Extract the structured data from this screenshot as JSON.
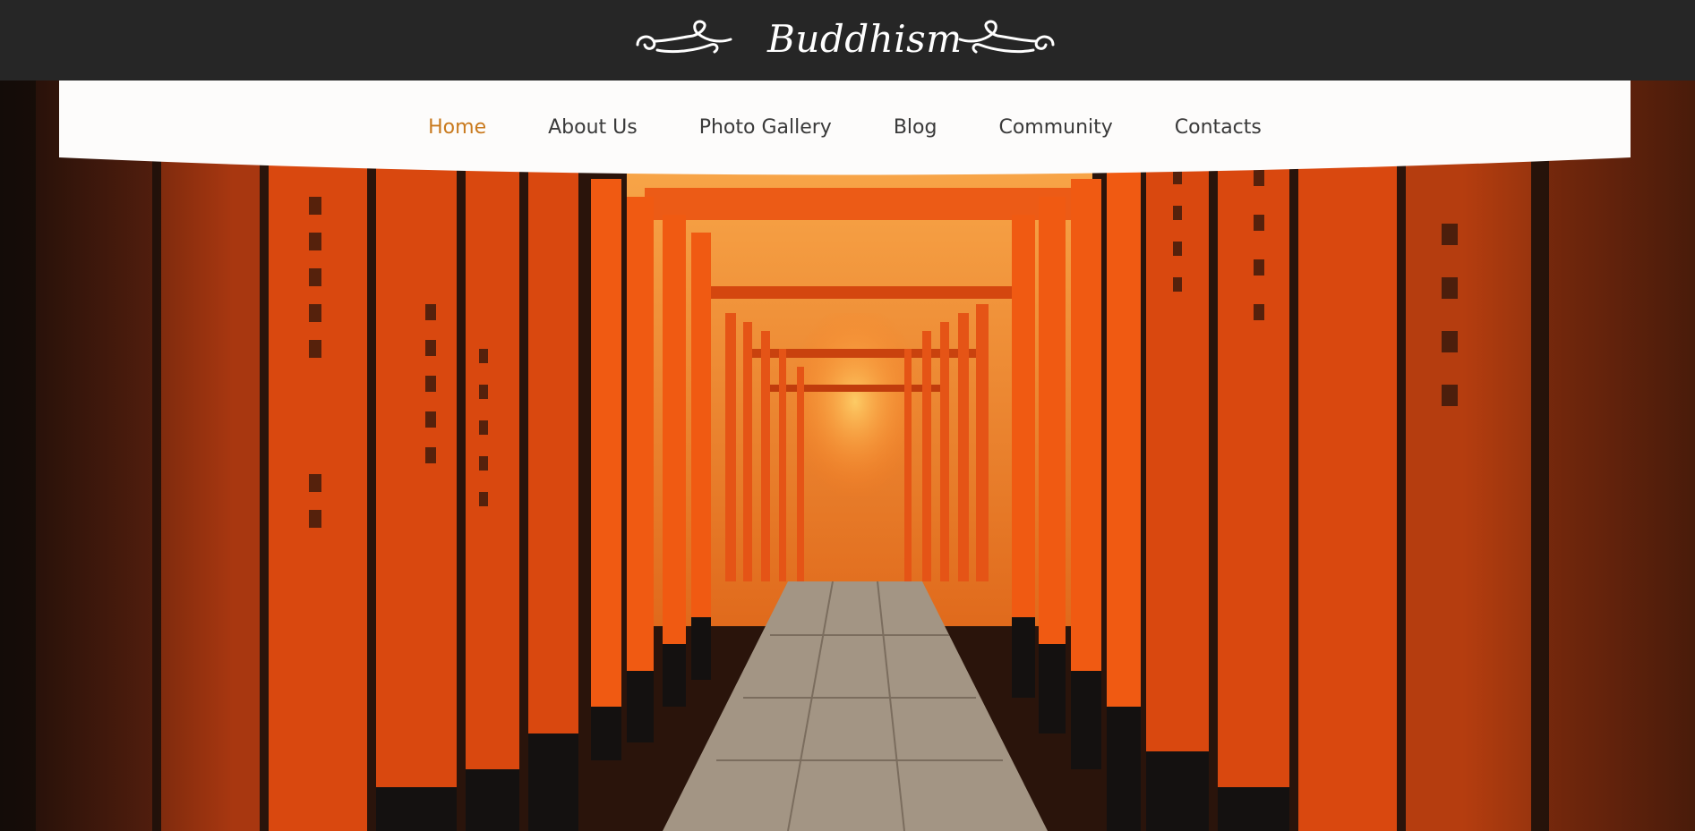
{
  "header": {
    "site_title": "Buddhism",
    "colors": {
      "bar": "#262626",
      "title": "#ffffff"
    },
    "icons": [
      "flourish-left-icon",
      "flourish-right-icon"
    ]
  },
  "nav": {
    "items": [
      {
        "label": "Home",
        "active": true
      },
      {
        "label": "About Us",
        "active": false
      },
      {
        "label": "Photo Gallery",
        "active": false
      },
      {
        "label": "Blog",
        "active": false
      },
      {
        "label": "Community",
        "active": false
      },
      {
        "label": "Contacts",
        "active": false
      }
    ],
    "colors": {
      "text": "#3a3a3a",
      "active": "#c97a1e",
      "band": "#fdfcfb"
    }
  },
  "hero": {
    "subject": "torii-gates-path-photo",
    "colors": {
      "gate": "#e4521a",
      "dark": "#1e1410",
      "path": "#a39584"
    }
  }
}
